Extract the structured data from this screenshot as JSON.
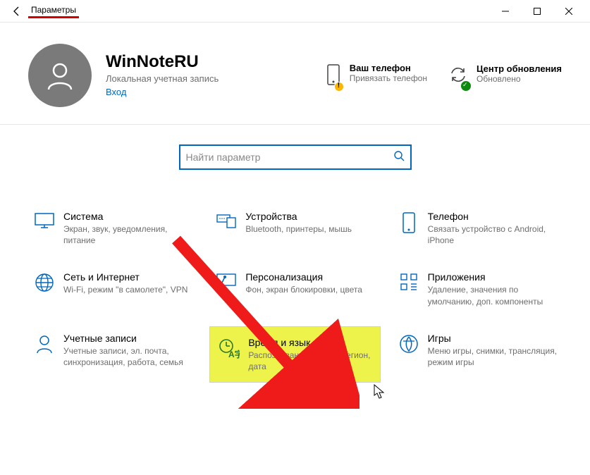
{
  "window": {
    "title": "Параметры"
  },
  "account": {
    "name": "WinNoteRU",
    "subtitle": "Локальная учетная запись",
    "link": "Вход"
  },
  "header_cards": {
    "phone": {
      "title": "Ваш телефон",
      "sub": "Привязать телефон"
    },
    "update": {
      "title": "Центр обновления",
      "sub": "Обновлено"
    }
  },
  "search": {
    "placeholder": "Найти параметр"
  },
  "tiles": [
    {
      "title": "Система",
      "sub": "Экран, звук, уведомления, питание"
    },
    {
      "title": "Устройства",
      "sub": "Bluetooth, принтеры, мышь"
    },
    {
      "title": "Телефон",
      "sub": "Связать устройство с Android, iPhone"
    },
    {
      "title": "Сеть и Интернет",
      "sub": "Wi-Fi, режим \"в самолете\", VPN"
    },
    {
      "title": "Персонализация",
      "sub": "Фон, экран блокировки, цвета"
    },
    {
      "title": "Приложения",
      "sub": "Удаление, значения по умолчанию, доп. компоненты"
    },
    {
      "title": "Учетные записи",
      "sub": "Учетные записи, эл. почта, синхронизация, работа, семья"
    },
    {
      "title": "Время и язык",
      "sub": "Распознавание голоса, регион, дата"
    },
    {
      "title": "Игры",
      "sub": "Меню игры, снимки, трансляция, режим игры"
    }
  ]
}
